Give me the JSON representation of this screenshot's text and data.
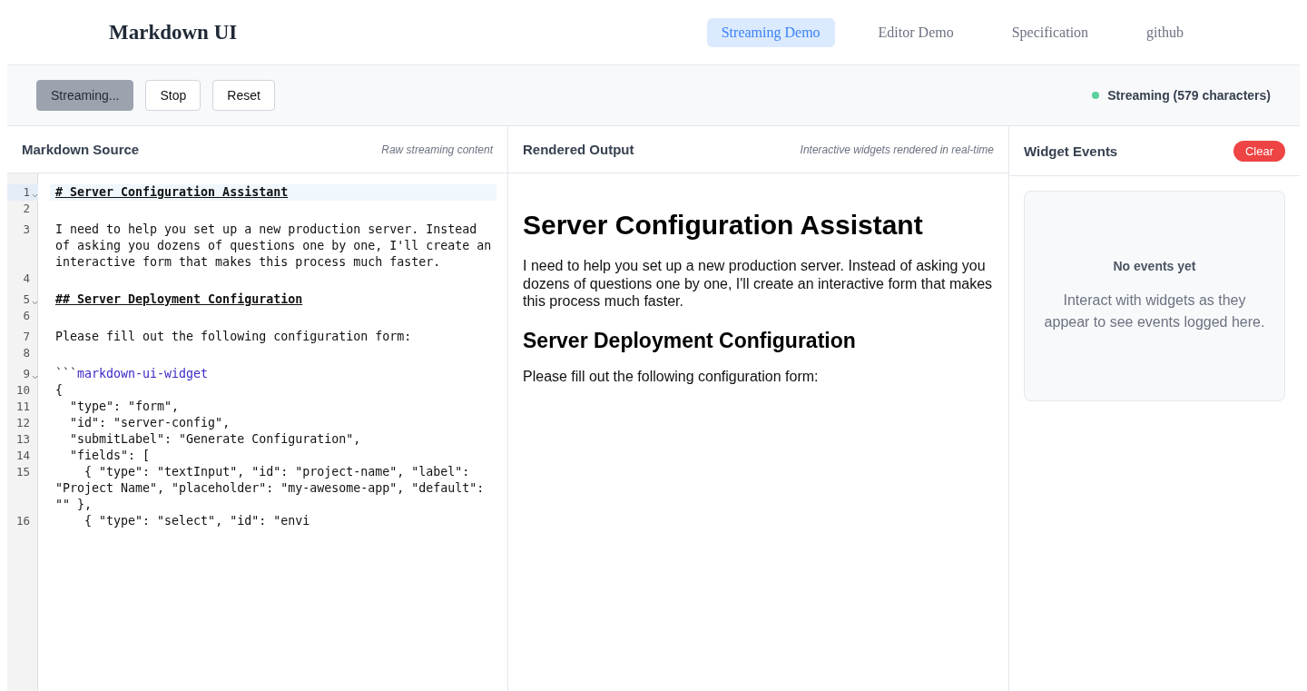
{
  "header": {
    "title": "Markdown UI",
    "nav": [
      {
        "label": "Streaming Demo",
        "selected": true
      },
      {
        "label": "Editor Demo",
        "selected": false
      },
      {
        "label": "Specification",
        "selected": false
      },
      {
        "label": "github",
        "selected": false
      }
    ]
  },
  "toolbar": {
    "buttons": [
      {
        "label": "Streaming...",
        "disabled": true
      },
      {
        "label": "Stop",
        "disabled": false
      },
      {
        "label": "Reset",
        "disabled": false
      }
    ],
    "status": {
      "text": "Streaming (579 characters)",
      "color": "#5ccf9f"
    }
  },
  "source": {
    "title": "Markdown Source",
    "subtitle": "Raw streaming content",
    "lines": [
      {
        "number": "1",
        "kind": "heading",
        "text": "# Server Configuration Assistant",
        "foldable": true,
        "selected": true
      },
      {
        "number": "2",
        "kind": "blank",
        "foldable": false,
        "selected": false
      },
      {
        "number": "3",
        "kind": "plain",
        "text": "I need to help you set up a new production server. Instead of asking you dozens of questions one by one, I'll create an interactive form that makes this process much faster.",
        "foldable": false,
        "selected": false
      },
      {
        "number": "4",
        "kind": "blank",
        "foldable": false,
        "selected": false
      },
      {
        "number": "5",
        "kind": "heading",
        "text": "## Server Deployment Configuration",
        "foldable": true,
        "selected": false
      },
      {
        "number": "6",
        "kind": "blank",
        "foldable": false,
        "selected": false
      },
      {
        "number": "7",
        "kind": "plain",
        "text": "Please fill out the following configuration form:",
        "foldable": false,
        "selected": false
      },
      {
        "number": "8",
        "kind": "blank",
        "foldable": false,
        "selected": false
      },
      {
        "number": "9",
        "kind": "fence",
        "text": "```",
        "lang": "markdown-ui-widget",
        "foldable": true,
        "selected": false
      },
      {
        "number": "10",
        "kind": "plain",
        "text": "{",
        "foldable": false,
        "selected": false
      },
      {
        "number": "11",
        "kind": "plain",
        "text": "  \"type\": \"form\",",
        "foldable": false,
        "selected": false
      },
      {
        "number": "12",
        "kind": "plain",
        "text": "  \"id\": \"server-config\",",
        "foldable": false,
        "selected": false
      },
      {
        "number": "13",
        "kind": "plain",
        "text": "  \"submitLabel\": \"Generate Configuration\",",
        "foldable": false,
        "selected": false
      },
      {
        "number": "14",
        "kind": "plain",
        "text": "  \"fields\": [",
        "foldable": false,
        "selected": false
      },
      {
        "number": "15",
        "kind": "plain",
        "text": "    { \"type\": \"textInput\", \"id\": \"project-name\", \"label\": \"Project Name\", \"placeholder\": \"my-awesome-app\", \"default\": \"\" },",
        "foldable": false,
        "selected": false
      },
      {
        "number": "16",
        "kind": "plain",
        "text": "    { \"type\": \"select\", \"id\": \"envi",
        "foldable": false,
        "selected": false
      }
    ]
  },
  "output": {
    "title": "Rendered Output",
    "subtitle": "Interactive widgets rendered in real-time",
    "blocks": [
      {
        "kind": "h1",
        "text": "Server Configuration Assistant"
      },
      {
        "kind": "p",
        "text": "I need to help you set up a new production server. Instead of asking you dozens of questions one by one, I'll create an interactive form that makes this process much faster."
      },
      {
        "kind": "h2",
        "text": "Server Deployment Configuration"
      },
      {
        "kind": "p",
        "text": "Please fill out the following configuration form:"
      }
    ]
  },
  "events": {
    "title": "Widget Events",
    "clear": "Clear",
    "empty_title": "No events yet",
    "empty_text": "Interact with widgets as they appear to see events logged here."
  }
}
